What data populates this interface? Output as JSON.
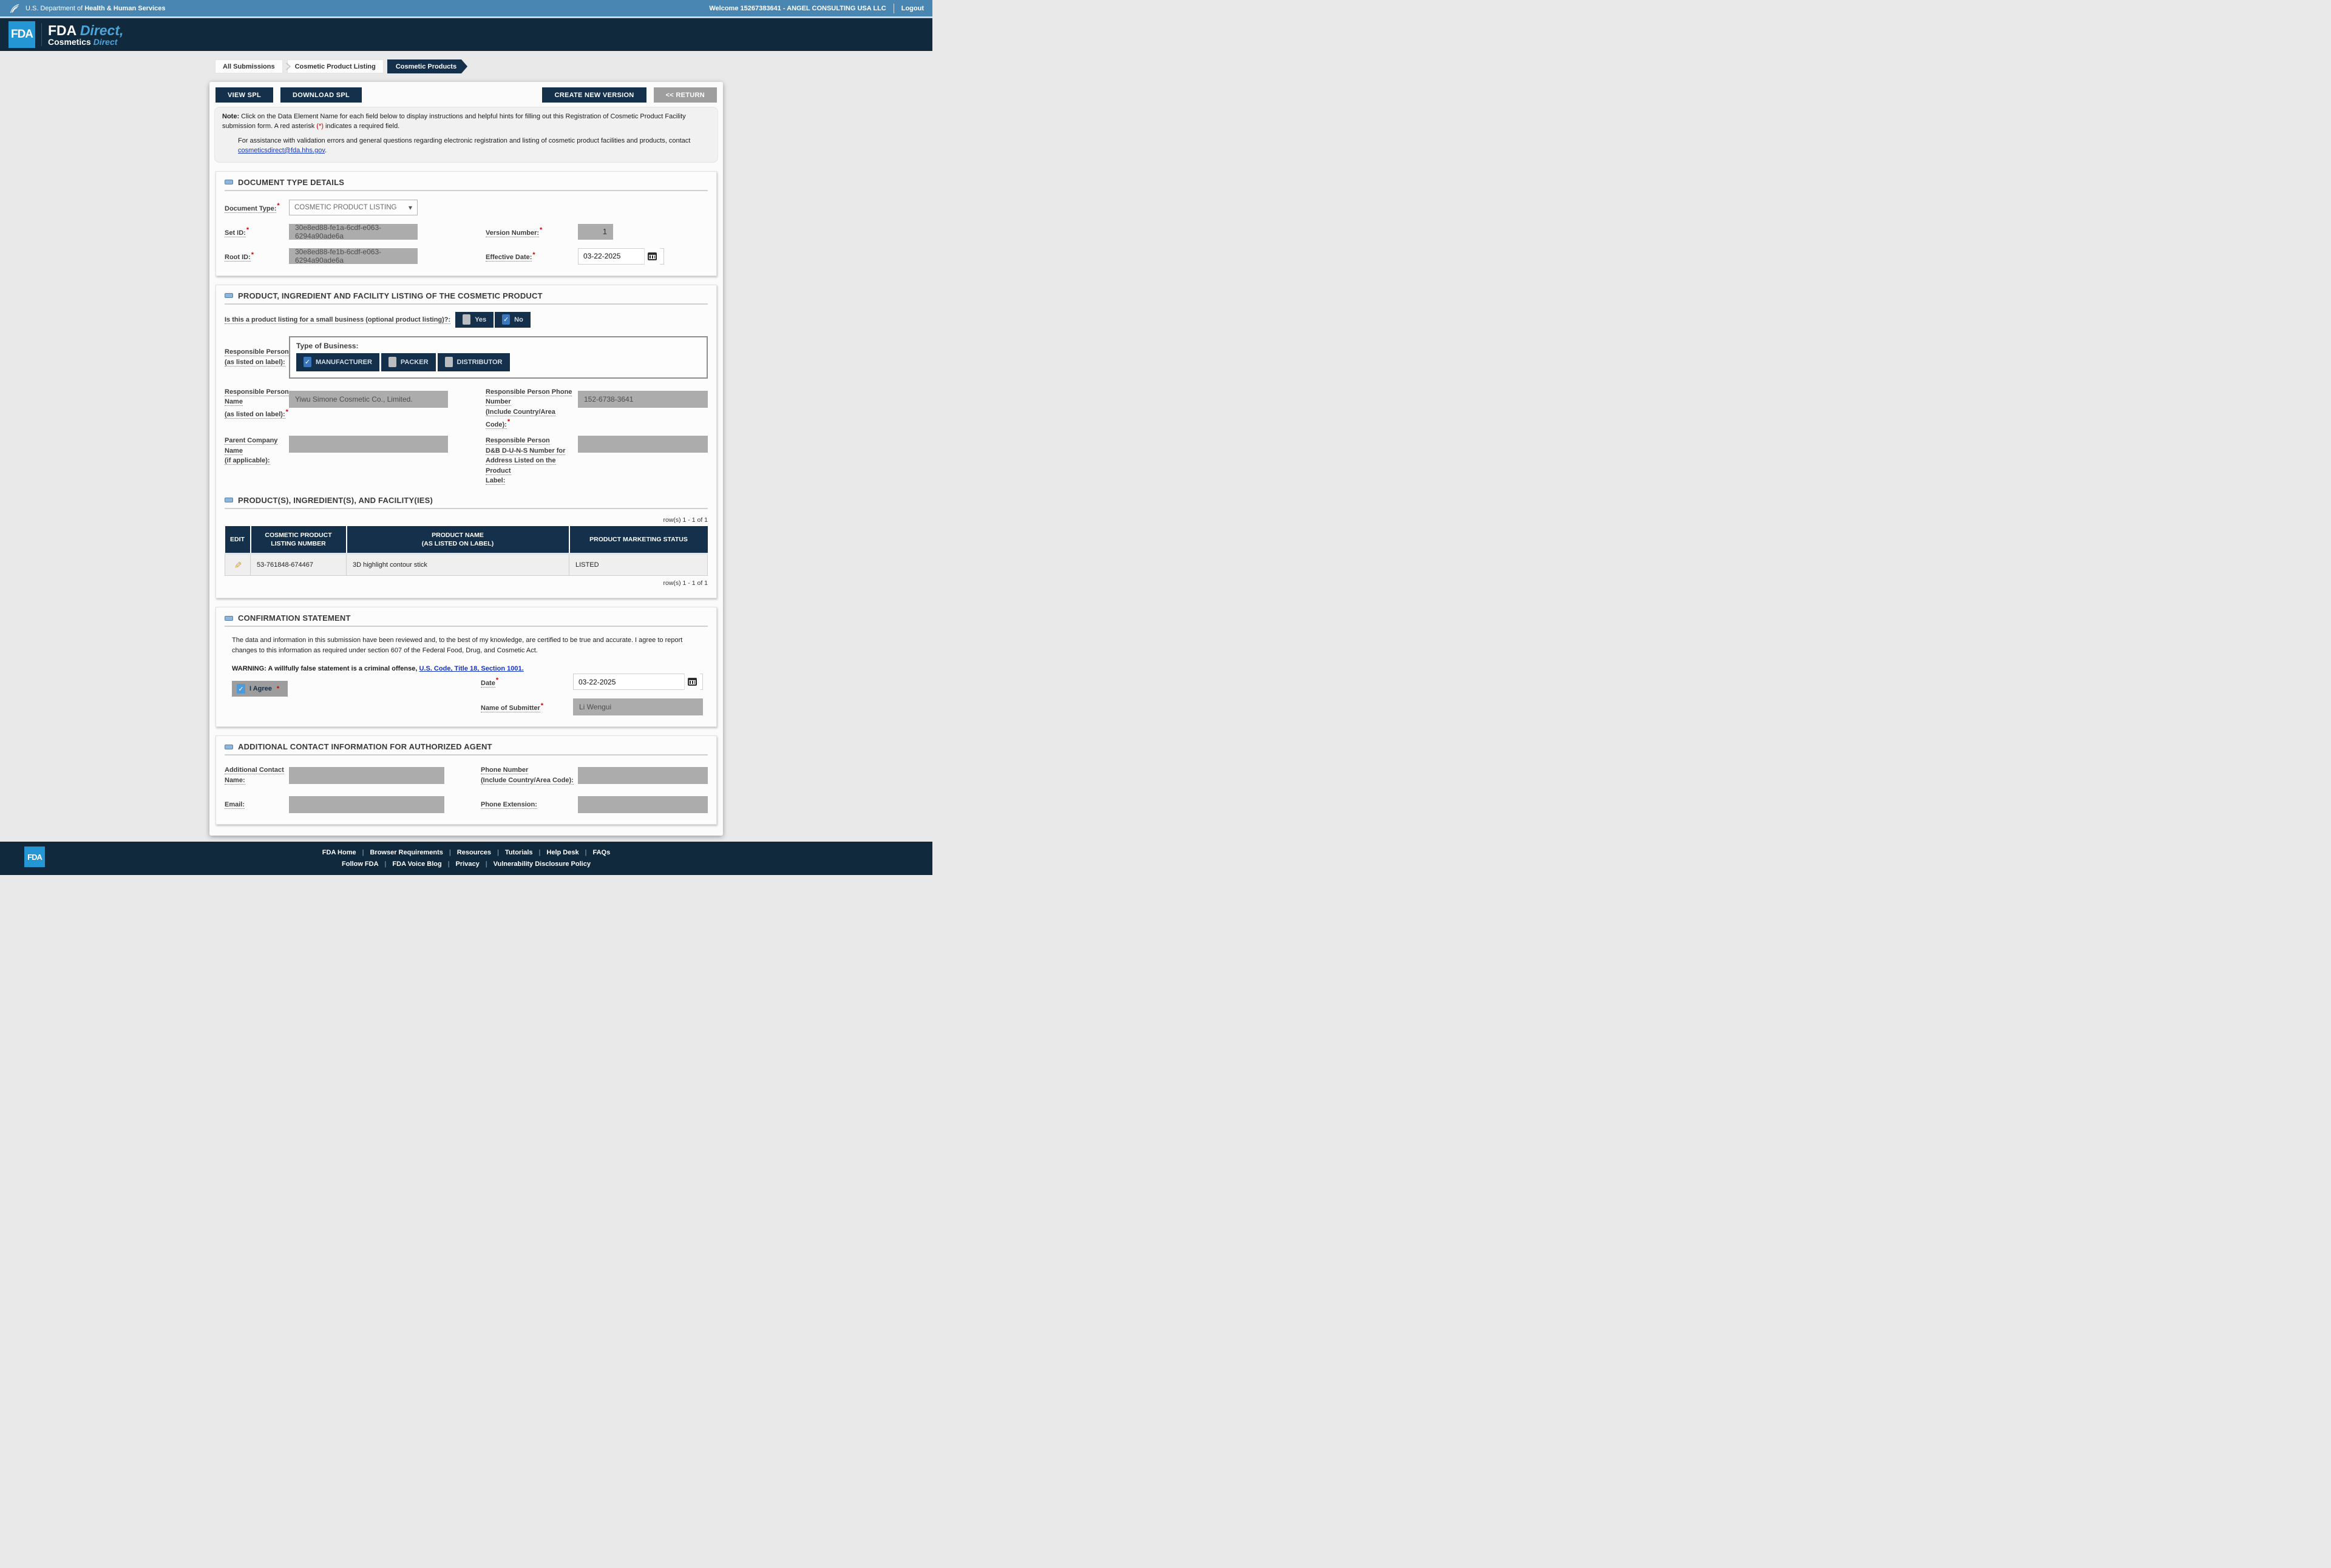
{
  "misc": {
    "required_marker": "*",
    "separator": "|"
  },
  "icons": {
    "check": "✓",
    "pencil": "✎",
    "chevron_down": "▾"
  },
  "colors": {
    "navy": "#14304a",
    "header_blue": "#4987b2",
    "fda_blue": "#2496d3",
    "accent_blue": "#4ba4da",
    "readonly_gray": "#acacac",
    "link_blue": "#1535c4",
    "required_red": "#cc0000",
    "checked_blue": "#3a76bb"
  },
  "header": {
    "hhs_label_regular": "U.S. Department of ",
    "hhs_label_bold": "Health & Human Services",
    "welcome": "Welcome 15267383641 - ANGEL CONSULTING USA LLC",
    "logout": "Logout",
    "fda_abbr": "FDA",
    "brand_top_bold": "FDA ",
    "brand_top_accent": "Direct,",
    "brand_bottom_bold": "Cosmetics ",
    "brand_bottom_accent": "Direct"
  },
  "breadcrumb": {
    "items": [
      "All Submissions",
      "Cosmetic Product Listing",
      "Cosmetic Products"
    ]
  },
  "toolbar": {
    "view_spl": "VIEW SPL",
    "download_spl": "DOWNLOAD SPL",
    "create_new_version": "CREATE NEW VERSION",
    "return": "<< RETURN"
  },
  "note": {
    "prefix": "Note:",
    "body": " Click on the Data Element Name for each field below to display instructions and helpful hints for filling out this Registration of Cosmetic Product Facility submission form. A red asterisk ",
    "asterisk": "(*)",
    "suffix": " indicates a required field.",
    "assistance_text": "For assistance with validation errors and general questions regarding electronic registration and listing of cosmetic product facilities and products, contact ",
    "assistance_link": "cosmeticsdirect@fda.hhs.gov",
    "assistance_period": "."
  },
  "document_type_details": {
    "title": "DOCUMENT TYPE DETAILS",
    "document_type_label": "Document Type:",
    "document_type_value": "COSMETIC PRODUCT LISTING",
    "set_id_label": "Set ID:",
    "set_id_value": "30e8ed88-fe1a-6cdf-e063-6294a90ade6a",
    "root_id_label": "Root ID:",
    "root_id_value": "30e8ed88-fe1b-6cdf-e063-6294a90ade6a",
    "version_label": "Version Number:",
    "version_value": "1",
    "effective_date_label": "Effective Date:",
    "effective_date_value": "03-22-2025"
  },
  "product_section": {
    "title": "PRODUCT, INGREDIENT AND FACILITY LISTING OF THE COSMETIC PRODUCT",
    "small_business_label": "Is this a product listing for a small business (optional product listing)?:",
    "yes_label": "Yes",
    "no_label": "No",
    "rp_label_line1": "Responsible Person",
    "rp_label_line2": "(as listed on label):",
    "type_of_business_label": "Type of Business:",
    "business_types": [
      "MANUFACTURER",
      "PACKER",
      "DISTRIBUTOR"
    ],
    "rp_name_label_line1": "Responsible Person",
    "rp_name_label_line2": "Name",
    "rp_name_label_line3": "(as listed on label):",
    "rp_name_value": "Yiwu Simone Cosmetic Co., Limited.",
    "parent_label_line1": "Parent Company Name",
    "parent_label_line2": "(if applicable):",
    "parent_value": "",
    "rp_phone_label_line1": "Responsible Person Phone",
    "rp_phone_label_line2": "Number",
    "rp_phone_label_line3": "(Include Country/Area Code):",
    "rp_phone_value": "152-6738-3641",
    "duns_label_line1": "Responsible Person",
    "duns_label_line2": "D&B D-U-N-S Number for",
    "duns_label_line3": "Address Listed on the Product",
    "duns_label_line4": "Label:",
    "duns_value": ""
  },
  "products_table": {
    "title": "PRODUCT(S), INGREDIENT(S), AND FACILITY(IES)",
    "row_count_text": "row(s) 1 - 1 of 1",
    "headers": {
      "edit": "EDIT",
      "listing_l1": "COSMETIC PRODUCT",
      "listing_l2": "LISTING NUMBER",
      "name_l1": "PRODUCT NAME",
      "name_l2": "(AS LISTED ON LABEL)",
      "status": "PRODUCT MARKETING STATUS"
    },
    "rows": [
      {
        "listing_number": "53-761848-674467",
        "product_name": "3D highlight contour stick",
        "marketing_status": "LISTED"
      }
    ]
  },
  "confirmation": {
    "title": "CONFIRMATION STATEMENT",
    "statement": "The data and information in this submission have been reviewed and, to the best of my knowledge, are certified to be true and accurate. I agree to report changes to this information as required under section 607 of the Federal Food, Drug, and Cosmetic Act.",
    "warning_prefix": "WARNING: A willfully false statement is a criminal offense, ",
    "warning_link": "U.S. Code, Title 18, Section 1001.",
    "i_agree_label": "I Agree",
    "date_label": "Date",
    "date_value": "03-22-2025",
    "submitter_label": "Name of Submitter",
    "submitter_value": "Li Wengui"
  },
  "additional_contact": {
    "title": "ADDITIONAL CONTACT INFORMATION FOR AUTHORIZED AGENT",
    "name_label_line1": "Additional Contact",
    "name_label_line2": "Name:",
    "name_value": "",
    "phone_label_line1": "Phone Number",
    "phone_label_line2": "(Include Country/Area Code):",
    "phone_value": "",
    "email_label": "Email:",
    "email_value": "",
    "extension_label": "Phone Extension:",
    "extension_value": ""
  },
  "footer": {
    "fda_abbr": "FDA",
    "links_row1": [
      "FDA Home",
      "Browser Requirements",
      "Resources",
      "Tutorials",
      "Help Desk",
      "FAQs"
    ],
    "links_row2": [
      "Follow FDA",
      "FDA Voice Blog",
      "Privacy",
      "Vulnerability Disclosure Policy"
    ]
  }
}
